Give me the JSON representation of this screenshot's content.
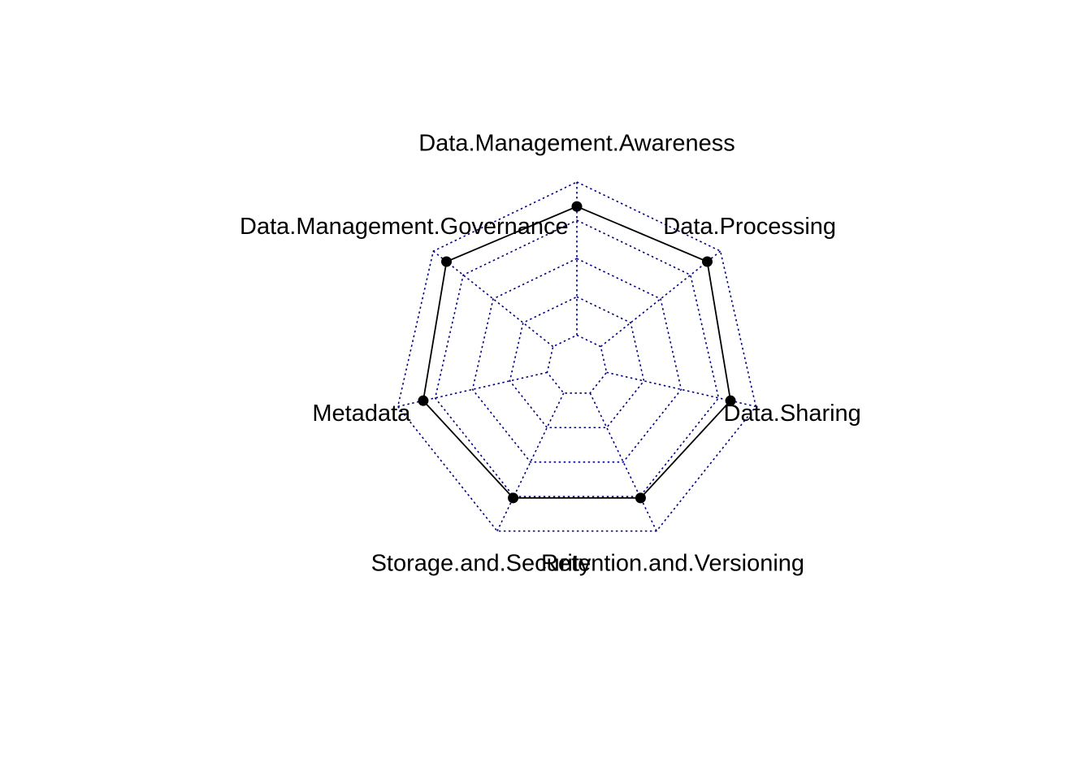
{
  "chart_data": {
    "type": "radar",
    "title": "",
    "axes": [
      "Data.Management.Awareness",
      "Data.Processing",
      "Data.Sharing",
      "Retention.and.Versioning",
      "Storage.and.Security",
      "Metadata",
      "Data.Management.Governance"
    ],
    "series": [
      {
        "values": [
          0.84,
          0.89,
          0.83,
          0.76,
          0.76,
          0.83,
          0.89
        ]
      }
    ],
    "range": [
      0,
      1
    ],
    "grid_levels": [
      0,
      0.25,
      0.5,
      0.75,
      1.0
    ],
    "grid": true,
    "legend": "none"
  },
  "colors": {
    "grid": "#000080",
    "series_line": "#000000",
    "series_point": "#000000",
    "background": "#ffffff"
  }
}
